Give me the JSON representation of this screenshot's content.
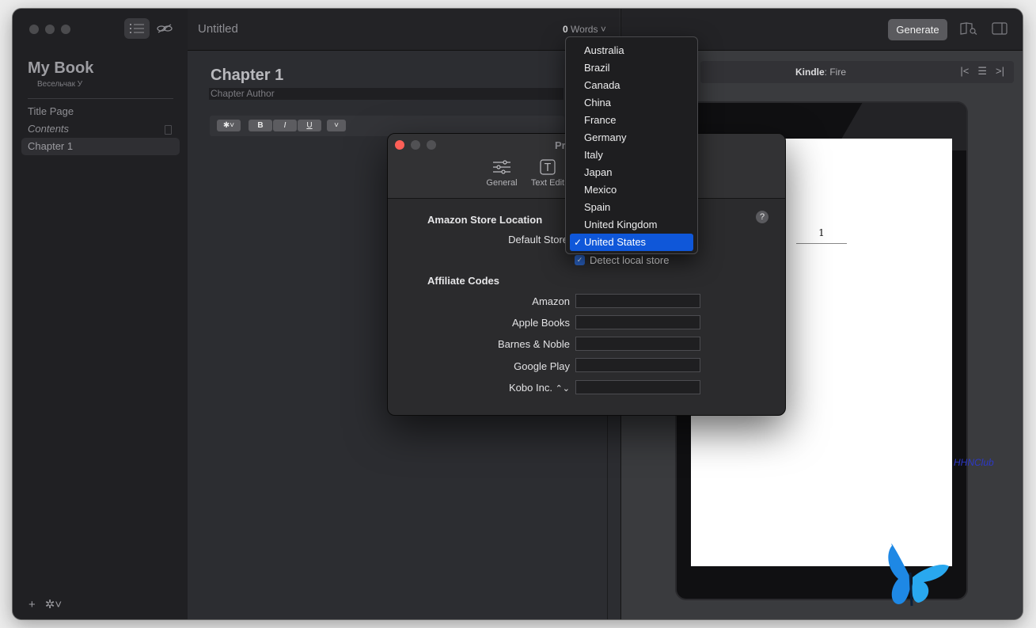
{
  "sidebar": {
    "book_title": "My Book",
    "book_author": "Весельчак У",
    "items": [
      {
        "label": "Title Page"
      },
      {
        "label": "Contents"
      },
      {
        "label": "Chapter 1"
      }
    ]
  },
  "editor": {
    "doc_title": "Untitled",
    "word_count": "0",
    "word_label": "Words",
    "chapter_title": "Chapter 1",
    "chapter_author_placeholder": "Chapter Author",
    "format": {
      "bold": "B",
      "italic": "I",
      "underline": "U"
    }
  },
  "preview": {
    "generate_label": "Generate",
    "device_brand": "Kindle",
    "device_model": ": Fire",
    "page_number": "1",
    "watermark": "HHNClub"
  },
  "preferences": {
    "title": "Pr",
    "tabs": [
      {
        "label": "General",
        "icon": "sliders-icon"
      },
      {
        "label": "Text Edit",
        "icon": "text-box-icon"
      }
    ],
    "store_section": "Amazon Store Location",
    "default_store_label": "Default Store",
    "detect_local_label": "Detect local store",
    "detect_local_checked": true,
    "affiliate_section": "Affiliate Codes",
    "affiliate_fields": [
      {
        "label": "Amazon",
        "value": ""
      },
      {
        "label": "Apple Books",
        "value": ""
      },
      {
        "label": "Barnes & Noble",
        "value": ""
      },
      {
        "label": "Google Play",
        "value": ""
      },
      {
        "label": "Kobo Inc.",
        "value": ""
      }
    ]
  },
  "store_menu": {
    "options": [
      "Australia",
      "Brazil",
      "Canada",
      "China",
      "France",
      "Germany",
      "Italy",
      "Japan",
      "Mexico",
      "Spain",
      "United Kingdom",
      "United States"
    ],
    "selected": "United States"
  },
  "colors": {
    "accent": "#0f57d9",
    "close_button": "#fe5f57",
    "checkbox": "#2a63c6"
  }
}
